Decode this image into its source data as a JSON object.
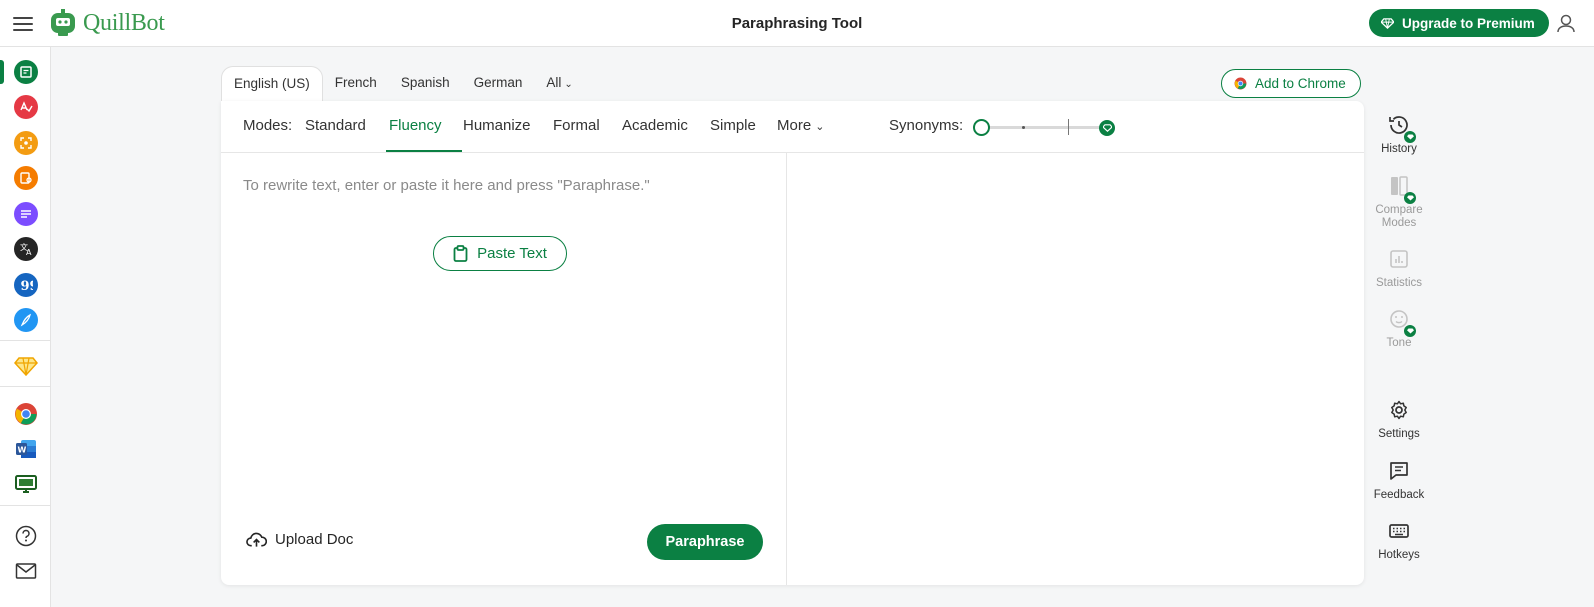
{
  "topbar": {
    "brand": "QuillBot",
    "page_title": "Paraphrasing Tool",
    "upgrade_label": "Upgrade to Premium"
  },
  "leftnav": {
    "items": [
      {
        "name": "paraphraser",
        "color": "#0b8043",
        "active": true
      },
      {
        "name": "grammar-checker",
        "color": "#e53945"
      },
      {
        "name": "ai-detector",
        "color": "#f39c12"
      },
      {
        "name": "plagiarism-checker",
        "color": "#f57c00"
      },
      {
        "name": "summarizer",
        "color": "#7c4dff"
      },
      {
        "name": "translator",
        "color": "#252525"
      },
      {
        "name": "citation-generator",
        "color": "#1565c0"
      },
      {
        "name": "ai-writer",
        "color": "#2196f3"
      },
      {
        "name": "premium",
        "color": "#f0a500"
      },
      {
        "name": "chrome-extension"
      },
      {
        "name": "word-addin",
        "color": "#2b579a"
      },
      {
        "name": "desktop-app",
        "color": "#1b5e20"
      },
      {
        "name": "help"
      },
      {
        "name": "contact"
      }
    ]
  },
  "languages": {
    "tabs": [
      "English (US)",
      "French",
      "Spanish",
      "German",
      "All"
    ],
    "active": "English (US)"
  },
  "add_to_chrome_label": "Add to Chrome",
  "modes": {
    "label": "Modes:",
    "items": [
      "Standard",
      "Fluency",
      "Humanize",
      "Formal",
      "Academic",
      "Simple",
      "More"
    ],
    "active": "Fluency"
  },
  "synonyms": {
    "label": "Synonyms:",
    "level": 0
  },
  "editor": {
    "placeholder": "To rewrite text, enter or paste it here and press \"Paraphrase.\"",
    "paste_label": "Paste Text",
    "upload_label": "Upload Doc",
    "paraphrase_label": "Paraphrase"
  },
  "tools": [
    {
      "label": "History",
      "enabled": true,
      "premium": true
    },
    {
      "label": "Compare\nModes",
      "enabled": false,
      "premium": true
    },
    {
      "label": "Statistics",
      "enabled": false
    },
    {
      "label": "Tone",
      "enabled": false,
      "premium": true
    },
    {
      "label": "Settings",
      "enabled": true
    },
    {
      "label": "Feedback",
      "enabled": true
    },
    {
      "label": "Hotkeys",
      "enabled": true
    }
  ],
  "colors": {
    "brand": "#0b8043",
    "brand_light": "#3a9a4f"
  }
}
